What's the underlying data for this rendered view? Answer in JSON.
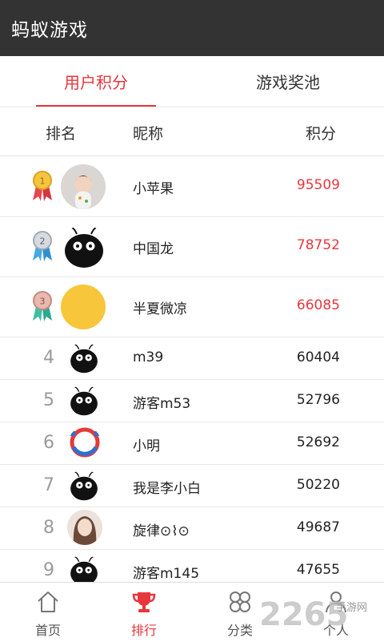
{
  "app": {
    "title": "蚂蚁游戏"
  },
  "tabs": [
    {
      "label": "用户积分",
      "active": true
    },
    {
      "label": "游戏奖池",
      "active": false
    }
  ],
  "columns": {
    "rank": "排名",
    "nickname": "昵称",
    "score": "积分"
  },
  "accent_color": "#e8363f",
  "rows": [
    {
      "rank": "1",
      "avatar": "baby-photo-avatar",
      "name": "小苹果",
      "score": "95509"
    },
    {
      "rank": "2",
      "avatar": "ant-avatar",
      "name": "中国龙",
      "score": "78752"
    },
    {
      "rank": "3",
      "avatar": "yellow-circle-avatar",
      "name": "半夏微凉",
      "score": "66085"
    },
    {
      "rank": "4",
      "avatar": "ant-avatar",
      "name": "m39",
      "score": "60404"
    },
    {
      "rank": "5",
      "avatar": "ant-avatar",
      "name": "游客m53",
      "score": "52796"
    },
    {
      "rank": "6",
      "avatar": "ring-avatar",
      "name": "小明",
      "score": "52692"
    },
    {
      "rank": "7",
      "avatar": "ant-avatar",
      "name": "我是李小白",
      "score": "50220"
    },
    {
      "rank": "8",
      "avatar": "girl-photo-avatar",
      "name": "旋律⊙⌇⊙",
      "score": "49687"
    },
    {
      "rank": "9",
      "avatar": "ant-avatar",
      "name": "游客m145",
      "score": "47655"
    }
  ],
  "bottom_nav": [
    {
      "label": "首页",
      "icon": "home-icon",
      "active": false
    },
    {
      "label": "排行",
      "icon": "trophy-icon",
      "active": true
    },
    {
      "label": "分类",
      "icon": "category-icon",
      "active": false
    },
    {
      "label": "个人",
      "icon": "person-icon",
      "active": false
    }
  ],
  "watermark": {
    "text": "2265",
    "subtext": "手游网"
  }
}
